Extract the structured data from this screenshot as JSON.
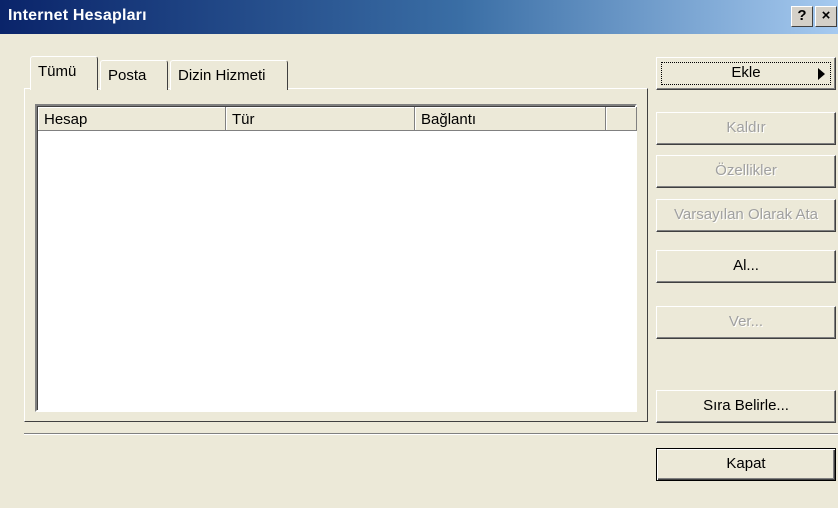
{
  "window": {
    "title": "Internet Hesapları",
    "help_button": "?",
    "close_button": "×"
  },
  "tabs": [
    {
      "label": "Tümü",
      "selected": true
    },
    {
      "label": "Posta",
      "selected": false
    },
    {
      "label": "Dizin Hizmeti",
      "selected": false
    }
  ],
  "list": {
    "columns": [
      "Hesap",
      "Tür",
      "Bağlantı"
    ],
    "rows": []
  },
  "buttons": {
    "ekle": {
      "label": "Ekle",
      "enabled": true
    },
    "kaldir": {
      "label": "Kaldır",
      "enabled": false
    },
    "ozellikler": {
      "label": "Özellikler",
      "enabled": false
    },
    "varsayilan": {
      "label": "Varsayılan Olarak Ata",
      "enabled": false
    },
    "al": {
      "label": "Al...",
      "enabled": true
    },
    "ver": {
      "label": "Ver...",
      "enabled": false
    },
    "sira": {
      "label": "Sıra Belirle...",
      "enabled": true
    },
    "kapat": {
      "label": "Kapat",
      "enabled": true
    }
  },
  "colors": {
    "titlebar_start": "#0a246a",
    "titlebar_end": "#a6caf0",
    "face": "#ece9d8"
  }
}
